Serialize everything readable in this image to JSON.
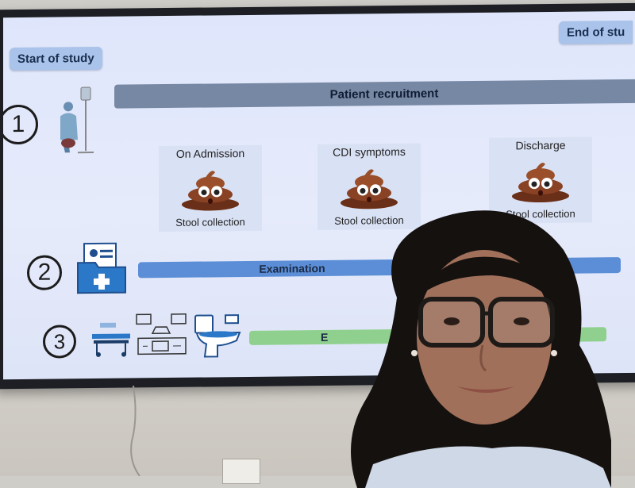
{
  "slide": {
    "start_label": "Start of study",
    "end_label": "End of stu",
    "step1_num": "1",
    "step2_num": "2",
    "step3_num": "3",
    "recruitment_label": "Patient recruitment",
    "examination_label": "Examination",
    "step3_bar_label": "E",
    "cards": [
      {
        "title": "On Admission",
        "caption": "Stool collection"
      },
      {
        "title": "CDI symptoms",
        "caption": "Stool collection"
      },
      {
        "title": "Discharge",
        "caption": "Stool collection"
      }
    ]
  },
  "icons": {
    "patient": "patient-with-iv-icon",
    "folder": "medical-folder-icon",
    "bed": "hospital-bed-icon",
    "lab": "laboratory-equipment-icon",
    "toilet": "toilet-icon",
    "poo": "poop-emoji-icon"
  },
  "colors": {
    "screen_bg": "#e2e8fa",
    "tag_bg": "#a9c3ea",
    "bar_gray": "#7788a4",
    "bar_blue": "#5b8ed7",
    "bar_green": "#8fd08f",
    "poo_brown": "#7a3a1f"
  }
}
